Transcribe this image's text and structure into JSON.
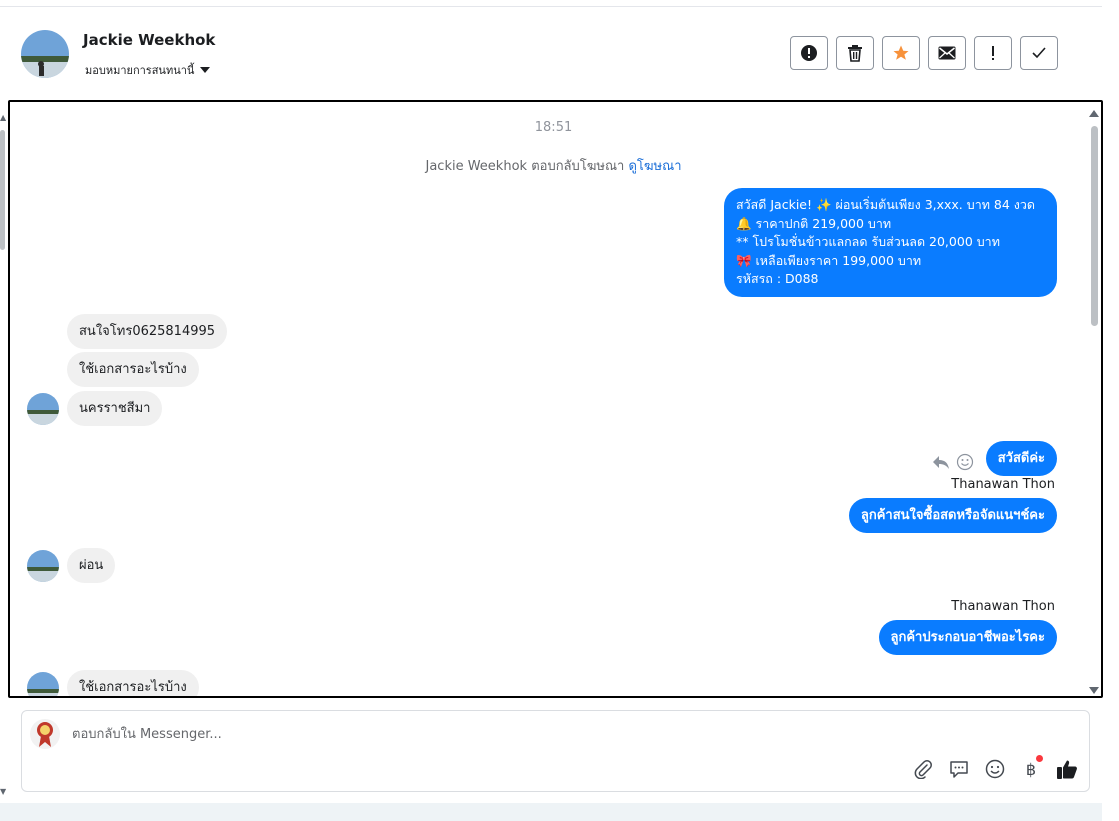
{
  "header": {
    "contact_name": "Jackie Weekhok",
    "assign_label": "มอบหมายการสนทนานี้",
    "actions": [
      {
        "icon": "alert-circle-icon",
        "name": "mark-spam-button"
      },
      {
        "icon": "trash-icon",
        "name": "delete-button"
      },
      {
        "icon": "star-icon",
        "name": "star-button"
      },
      {
        "icon": "envelope-icon",
        "name": "mark-unread-button"
      },
      {
        "icon": "exclamation-icon",
        "name": "follow-up-button"
      },
      {
        "icon": "check-icon",
        "name": "mark-done-button"
      }
    ]
  },
  "conversation": {
    "timestamp": "18:51",
    "ad_reply_text": "Jackie Weekhok ตอบกลับโฆษณา",
    "ad_link": "ดูโฆษณา",
    "promo_message": {
      "line1": "สวัสดี Jackie! ✨  ผ่อนเริ่มต้นเพียง 3,xxx. บาท 84 งวด",
      "line2": "🔔 ราคาปกติ 219,000 บาท",
      "line3": "** โปรโมชั่นข้าวแลกลด รับส่วนลด 20,000 บาท",
      "line4": "🎀  เหลือเพียงราคา 199,000 บาท",
      "line5": " รหัสรถ : D088"
    },
    "incoming_1": "สนใจโทร0625814995",
    "incoming_2": "ใช้เอกสารอะไรบ้าง",
    "incoming_3": "นครราชสีมา",
    "outgoing_hello": "สวัสดีค่ะ",
    "agent_name_1": "Thanawan Thon",
    "outgoing_ask_1": "ลูกค้าสนใจซื้อสดหรือจัดแนฯช์คะ",
    "incoming_4": "ผ่อน",
    "agent_name_2": "Thanawan Thon",
    "outgoing_ask_2": "ลูกค้าประกอบอาชีพอะไรคะ",
    "incoming_5": "ใช้เอกสารอะไรบ้าง"
  },
  "composer": {
    "placeholder": "ตอบกลับใน Messenger...",
    "currency_symbol": "฿",
    "tools": [
      "paperclip-icon",
      "saved-reply-icon",
      "emoji-icon",
      "baht-icon",
      "thumbs-up-icon"
    ]
  },
  "colors": {
    "outgoing_bubble": "#0a7cff",
    "incoming_bubble": "#f0f0f0",
    "star": "#f7923b",
    "link": "#1a6ed8"
  }
}
